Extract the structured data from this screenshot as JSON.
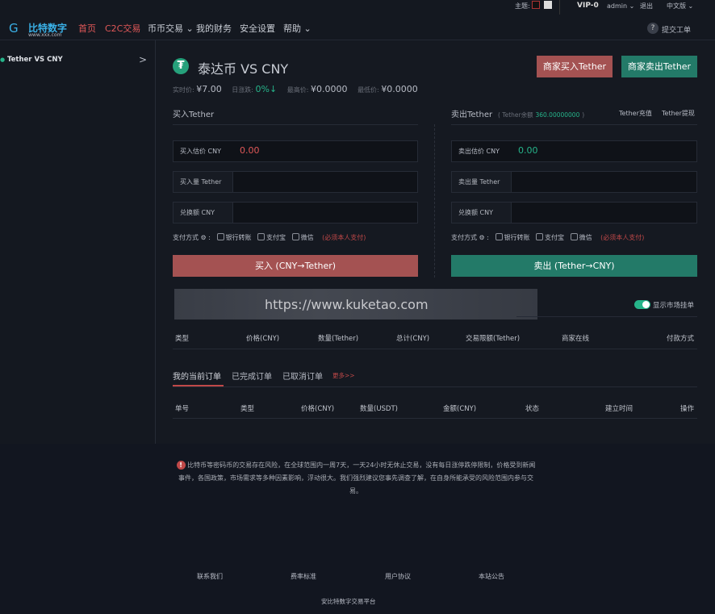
{
  "header": {
    "theme_label": "主题:",
    "vip": "VIP-0",
    "user": "admin",
    "logout": "退出",
    "language": "中文版",
    "logo_text": "比特数字",
    "logo_sub": "www.xxx.com",
    "nav": [
      {
        "label": "首页"
      },
      {
        "label": "C2C交易"
      },
      {
        "label": "币币交易"
      },
      {
        "label": "我的财务"
      },
      {
        "label": "安全设置"
      },
      {
        "label": "帮助"
      }
    ],
    "ticket": "提交工单"
  },
  "sidebar": {
    "items": [
      {
        "label": "Tether VS CNY"
      }
    ]
  },
  "market": {
    "title": "泰达币 VS CNY",
    "price_label": "实时价:",
    "price": "¥7.00",
    "change_label": "日涨跌:",
    "change": "0%↓",
    "high_label": "最高价:",
    "high": "¥0.0000",
    "low_label": "最低价:",
    "low": "¥0.0000",
    "merchant_buy": "商家买入Tether",
    "merchant_sell": "商家卖出Tether"
  },
  "buy": {
    "title": "买入Tether",
    "est_label": "买入估价 CNY",
    "est_value": "0.00",
    "amount_label": "买入量 Tether",
    "total_label": "兑换额 CNY",
    "pay_label": "支付方式",
    "methods": [
      "银行转账",
      "支付宝",
      "微信"
    ],
    "note": "(必须本人支付)",
    "button": "买入 (CNY→Tether)"
  },
  "sell": {
    "title": "卖出Tether",
    "balance_prefix": "( Tether余额",
    "balance": "360.00000000",
    "balance_suffix": ")",
    "deposit": "Tether充值",
    "withdraw": "Tether提现",
    "est_label": "卖出估价 CNY",
    "est_value": "0.00",
    "amount_label": "卖出量 Tether",
    "total_label": "兑换额 CNY",
    "pay_label": "支付方式",
    "methods": [
      "银行转账",
      "支付宝",
      "微信"
    ],
    "note": "(必须本人支付)",
    "button": "卖出 (Tether→CNY)"
  },
  "watermark": "https://www.kuketao.com",
  "market_list": {
    "toggle_label": "显示市场挂单",
    "columns": [
      "类型",
      "价格(CNY)",
      "数量(Tether)",
      "总计(CNY)",
      "交易限额(Tether)",
      "商家在线",
      "付款方式"
    ]
  },
  "orders": {
    "tabs": [
      "我的当前订单",
      "已完成订单",
      "已取消订单"
    ],
    "more": "更多>>",
    "columns": [
      "单号",
      "类型",
      "价格(CNY)",
      "数量(USDT)",
      "金额(CNY)",
      "状态",
      "建立时间",
      "操作"
    ]
  },
  "footer": {
    "risk": "比特币等密码币的交易存在风险，在全球范围内一周7天，一天24小时无休止交易，没有每日涨停跌停限制，价格受到新闻事件，各国政策，市场需求等多种因素影响，浮动很大。我们强烈建议您事先调查了解，在自身所能承受的风险范围内参与交易。",
    "links": [
      "联系我们",
      "费率标准",
      "用户协议",
      "本站公告"
    ],
    "copyright": "安比特数字交易平台"
  },
  "colors": {
    "red": "#a45252",
    "green": "#237a68",
    "accent_green": "#26b48a"
  }
}
